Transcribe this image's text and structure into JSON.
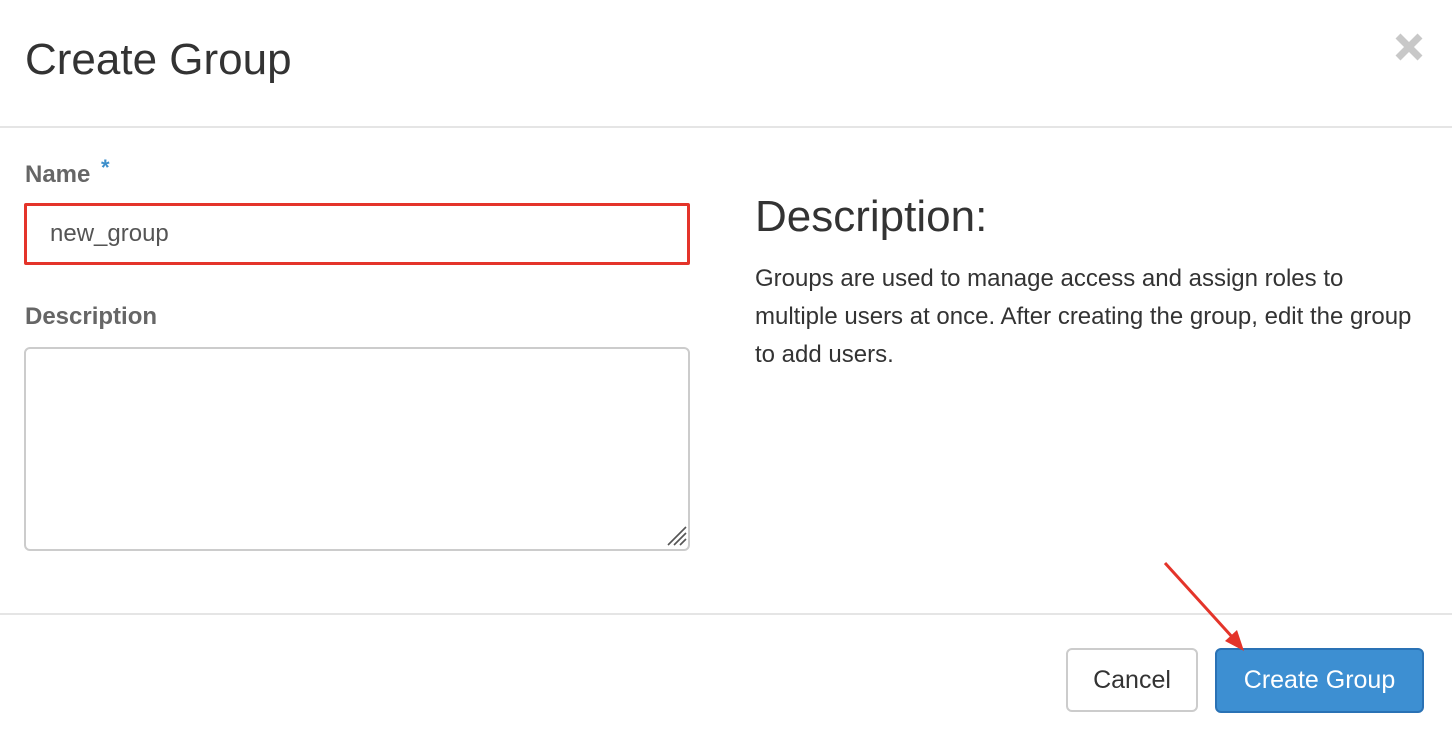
{
  "modal": {
    "title": "Create Group"
  },
  "form": {
    "name_label": "Name",
    "required_marker": "*",
    "name_value": "new_group",
    "description_label": "Description",
    "description_value": ""
  },
  "help": {
    "heading": "Description:",
    "text": "Groups are used to manage access and assign roles to multiple users at once. After creating the group, edit the group to add users."
  },
  "footer": {
    "cancel_label": "Cancel",
    "submit_label": "Create Group"
  },
  "icons": {
    "close": "close-icon",
    "resize": "resize-grip-icon"
  },
  "colors": {
    "primary": "#3d8fd2",
    "highlight_border": "#e4342a",
    "required_star": "#3d8fcb",
    "annotation_arrow": "#e4342a"
  }
}
